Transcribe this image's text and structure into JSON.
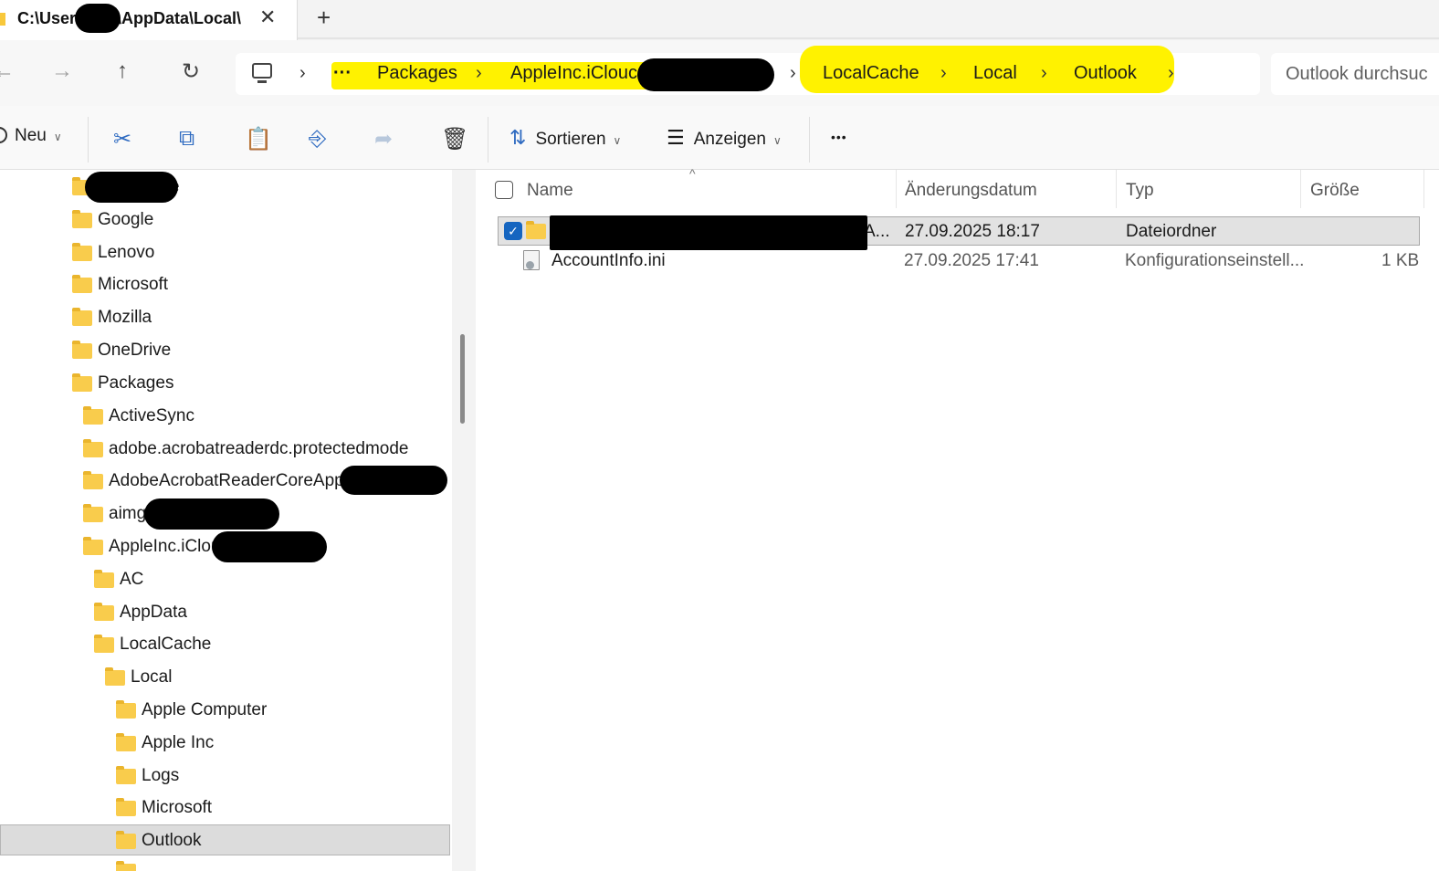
{
  "tab": {
    "title": "C:\\User   \\AppData\\Local\\",
    "close": "✕",
    "new_tab": "+"
  },
  "nav": {
    "back": "←",
    "forward": "→",
    "up": "↑",
    "refresh": "↻"
  },
  "address": {
    "overflow": "···",
    "separator": "›",
    "crumbs": [
      "Packages",
      "AppleInc.iClouc",
      "LocalCache",
      "Local",
      "Outlook"
    ]
  },
  "search": {
    "placeholder": "Outlook durchsuc"
  },
  "commandbar": {
    "new": "Neu",
    "sort": "Sortieren",
    "view": "Anzeigen",
    "more": "•••",
    "icons": [
      "cut-icon",
      "copy-icon",
      "paste-icon",
      "rename-icon",
      "share-icon",
      "delete-icon"
    ]
  },
  "sidebar": {
    "items": [
      {
        "label": "e"
      },
      {
        "label": "Google"
      },
      {
        "label": "Lenovo"
      },
      {
        "label": "Microsoft"
      },
      {
        "label": "Mozilla"
      },
      {
        "label": "OneDrive"
      },
      {
        "label": "Packages"
      },
      {
        "label": "ActiveSync"
      },
      {
        "label": "adobe.acrobatreaderdc.protectedmode"
      },
      {
        "label": "AdobeAcrobatReaderCoreApp_p"
      },
      {
        "label": "aimg"
      },
      {
        "label": "AppleInc.iClou"
      },
      {
        "label": "AC"
      },
      {
        "label": "AppData"
      },
      {
        "label": "LocalCache"
      },
      {
        "label": "Local"
      },
      {
        "label": "Apple Computer"
      },
      {
        "label": "Apple Inc"
      },
      {
        "label": "Logs"
      },
      {
        "label": "Microsoft"
      },
      {
        "label": "Outlook"
      }
    ],
    "selected": "Outlook"
  },
  "columns": {
    "name": "Name",
    "modified": "Änderungsdatum",
    "type": "Typ",
    "size": "Größe",
    "sort_indicator": "^"
  },
  "files": [
    {
      "name": "A...",
      "modified": "27.09.2025 18:17",
      "type": "Dateiordner",
      "size": "",
      "selected": true
    },
    {
      "name": "AccountInfo.ini",
      "modified": "27.09.2025 17:41",
      "type": "Konfigurationseinstell...",
      "size": "1 KB",
      "selected": false
    }
  ],
  "colors": {
    "highlight": "#fff200",
    "selection_check": "#1565c0",
    "folder": "#f9cc4c"
  }
}
